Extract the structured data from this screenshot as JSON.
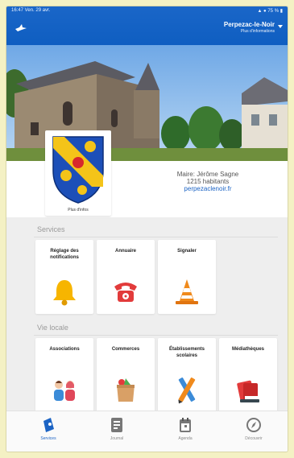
{
  "status_bar": {
    "left": "16:47  Ven. 29 avr.",
    "right": "▲ ● 75 % ▮"
  },
  "header": {
    "town": "Perpezac-le-Noir",
    "subtitle": "Plus d'informations"
  },
  "crest": {
    "caption": "Plus d'infos"
  },
  "town_info": {
    "mayor": "Maire: Jérôme Sagne",
    "population": "1215 habitants",
    "website": "perpezaclenoir.fr"
  },
  "sections": {
    "services": {
      "label": "Services",
      "tiles": [
        {
          "label": "Réglage des notifications",
          "icon": "bell-icon"
        },
        {
          "label": "Annuaire",
          "icon": "telephone-icon"
        },
        {
          "label": "Signaler",
          "icon": "traffic-cone-icon"
        }
      ]
    },
    "vie_locale": {
      "label": "Vie locale",
      "tiles": [
        {
          "label": "Associations",
          "icon": "people-icon"
        },
        {
          "label": "Commerces",
          "icon": "shopping-bag-icon"
        },
        {
          "label": "Établissements scolaires",
          "icon": "pencil-ruler-icon"
        },
        {
          "label": "Médiathèques",
          "icon": "books-icon"
        }
      ]
    }
  },
  "nav": [
    {
      "label": "Services",
      "icon": "services-icon",
      "active": true
    },
    {
      "label": "Journal",
      "icon": "journal-icon",
      "active": false
    },
    {
      "label": "Agenda",
      "icon": "calendar-icon",
      "active": false
    },
    {
      "label": "Découvrir",
      "icon": "compass-icon",
      "active": false
    }
  ],
  "colors": {
    "header_blue": "#1163c5",
    "accent_blue": "#1b63c4",
    "bell_yellow": "#f7b500",
    "phone_red": "#e23b3b",
    "cone_orange": "#f08a1c"
  }
}
